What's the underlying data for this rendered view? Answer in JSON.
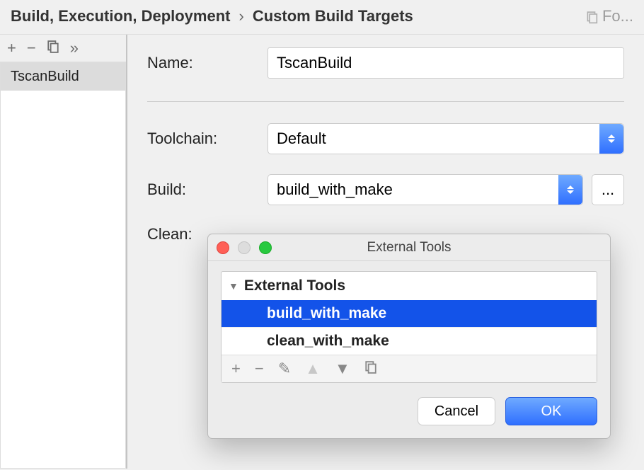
{
  "header": {
    "breadcrumb_parent": "Build, Execution, Deployment",
    "breadcrumb_child": "Custom Build Targets",
    "right_label": "Fo..."
  },
  "sidebar": {
    "items": [
      {
        "label": "TscanBuild"
      }
    ]
  },
  "form": {
    "name_label": "Name:",
    "name_value": "TscanBuild",
    "toolchain_label": "Toolchain:",
    "toolchain_value": "Default",
    "build_label": "Build:",
    "build_value": "build_with_make",
    "clean_label": "Clean:",
    "ellipsis": "..."
  },
  "dialog": {
    "title": "External Tools",
    "group_label": "External Tools",
    "items": [
      {
        "label": "build_with_make",
        "selected": true
      },
      {
        "label": "clean_with_make",
        "selected": false
      }
    ],
    "cancel_label": "Cancel",
    "ok_label": "OK"
  }
}
